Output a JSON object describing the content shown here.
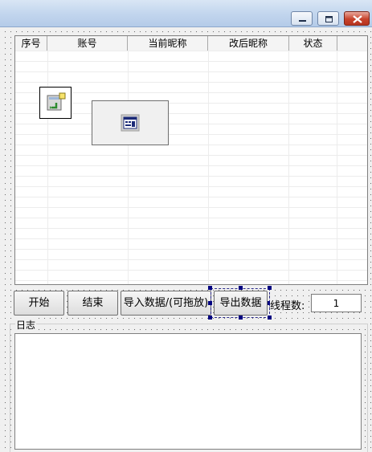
{
  "window": {
    "buttons": {
      "minimize": "minimize-icon",
      "maximize": "maximize-icon",
      "close": "close-icon"
    }
  },
  "table": {
    "columns": [
      "序号",
      "账号",
      "当前昵称",
      "改后昵称",
      "状态"
    ],
    "rows": []
  },
  "toolbar": {
    "start_label": "开始",
    "stop_label": "结束",
    "import_label": "导入数据/(可拖放)",
    "export_label": "导出数据",
    "threads_label": "线程数:",
    "threads_value": "1"
  },
  "log": {
    "title": "日志",
    "content": ""
  },
  "icons": {
    "nonvisual_component": "import-component-icon",
    "embedded_control": "form-control-icon"
  },
  "colors": {
    "selection_handle": "#000080",
    "titlebar": "#c3d6ee",
    "close_button": "#c7432c"
  }
}
